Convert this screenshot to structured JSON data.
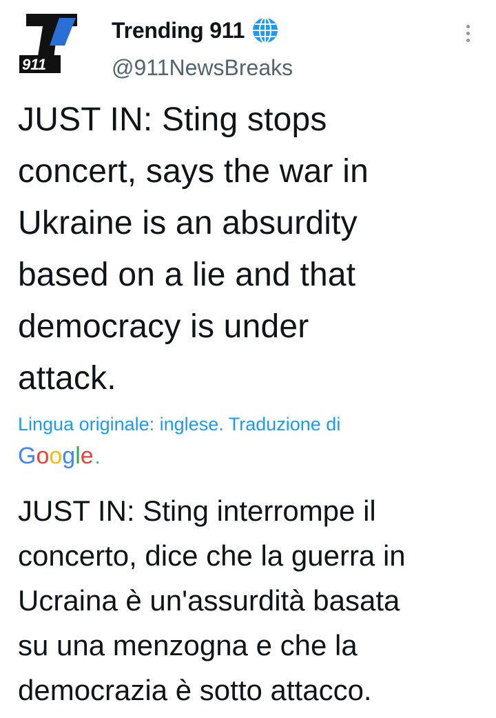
{
  "tweet": {
    "display_name": "Trending 911",
    "handle": "@911NewsBreaks",
    "logo_text": "911",
    "verified_icon": "globe-icon",
    "more_icon": "more-vertical-icon",
    "original_text": "JUST IN: Sting stops\nconcert, says the war in\nUkraine is an absurdity\nbased on a lie and that\ndemocracy is under\nattack.",
    "translation_label": "Lingua originale: inglese. Traduzione di",
    "translation_provider": ".",
    "google_letters": [
      "G",
      "o",
      "o",
      "g",
      "l",
      "e"
    ],
    "translated_text": "JUST IN: Sting interrompe il\nconcerto, dice che la guerra in\nUcraina è un'assurdità basata\nsu una menzogna e che la\ndemocrazia è sotto attacco."
  },
  "colors": {
    "link": "#1d9bf0",
    "secondary_text": "#536471",
    "google_blue": "#4285f4",
    "google_red": "#ea4335",
    "google_yellow": "#fbbc05",
    "google_green": "#34a853"
  }
}
